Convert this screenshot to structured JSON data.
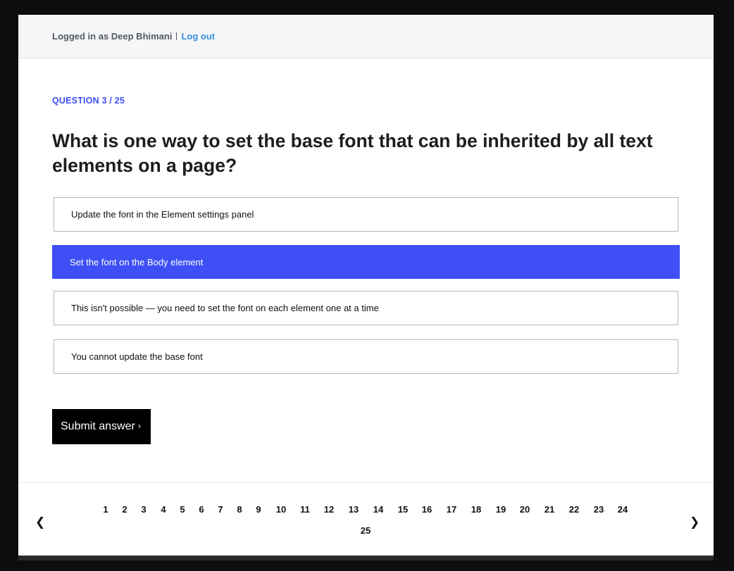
{
  "header": {
    "logged_in_text": "Logged in as Deep Bhimani",
    "logout_label": "Log out"
  },
  "quiz": {
    "question_counter": "QUESTION 3 / 25",
    "question_text": "What is one way to set the base font that can be inherited by all text elements on a page?",
    "options": [
      {
        "label": "Update the font in the Element settings panel",
        "selected": false
      },
      {
        "label": "Set the font on the Body element",
        "selected": true
      },
      {
        "label": "This isn't possible — you need to set the font on each element one at a time",
        "selected": false
      },
      {
        "label": "You cannot update the base font",
        "selected": false
      }
    ],
    "submit_label": "Submit answer",
    "submit_chevron": "›"
  },
  "pager": {
    "prev_icon": "❮",
    "next_icon": "❯",
    "pages": [
      "1",
      "2",
      "3",
      "4",
      "5",
      "6",
      "7",
      "8",
      "9",
      "10",
      "11",
      "12",
      "13",
      "14",
      "15",
      "16",
      "17",
      "18",
      "19",
      "20",
      "21",
      "22",
      "23",
      "24",
      "25"
    ]
  },
  "colors": {
    "accent": "#3d4ff5",
    "link": "#3b8fe0",
    "button": "#000000"
  }
}
